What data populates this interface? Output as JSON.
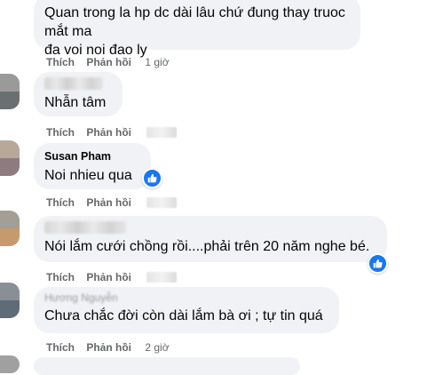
{
  "comments": [
    {
      "text_lines": [
        "Quan trong la hp dc dài lâu chứ đung thay truoc mắt ma",
        "đa voi noi đao ly"
      ],
      "actions": {
        "like": "Thích",
        "reply": "Phản hồi",
        "time": "1 giờ"
      }
    },
    {
      "text": "Nhẫn tâm",
      "actions": {
        "like": "Thích",
        "reply": "Phản hồi"
      }
    },
    {
      "author": "Susan Pham",
      "text": "Noi nhieu qua",
      "reaction": "like-icon",
      "actions": {
        "like": "Thích",
        "reply": "Phản hồi"
      }
    },
    {
      "text": "Nói lắm cưới chồng rồi....phải trên 20 năm nghe bé.",
      "reaction": "like-icon",
      "actions": {
        "like": "Thích",
        "reply": "Phản hồi"
      }
    },
    {
      "author_partial": "Hương Nguyễn",
      "text": "Chưa chắc đời còn dài lắm bà ơi ; tự tin quá",
      "actions": {
        "like": "Thích",
        "reply": "Phản hồi",
        "time": "2 giờ"
      }
    }
  ],
  "colors": {
    "bubble": "#f0f2f5",
    "action_text": "#65676b",
    "like_blue": "#1877f2"
  }
}
